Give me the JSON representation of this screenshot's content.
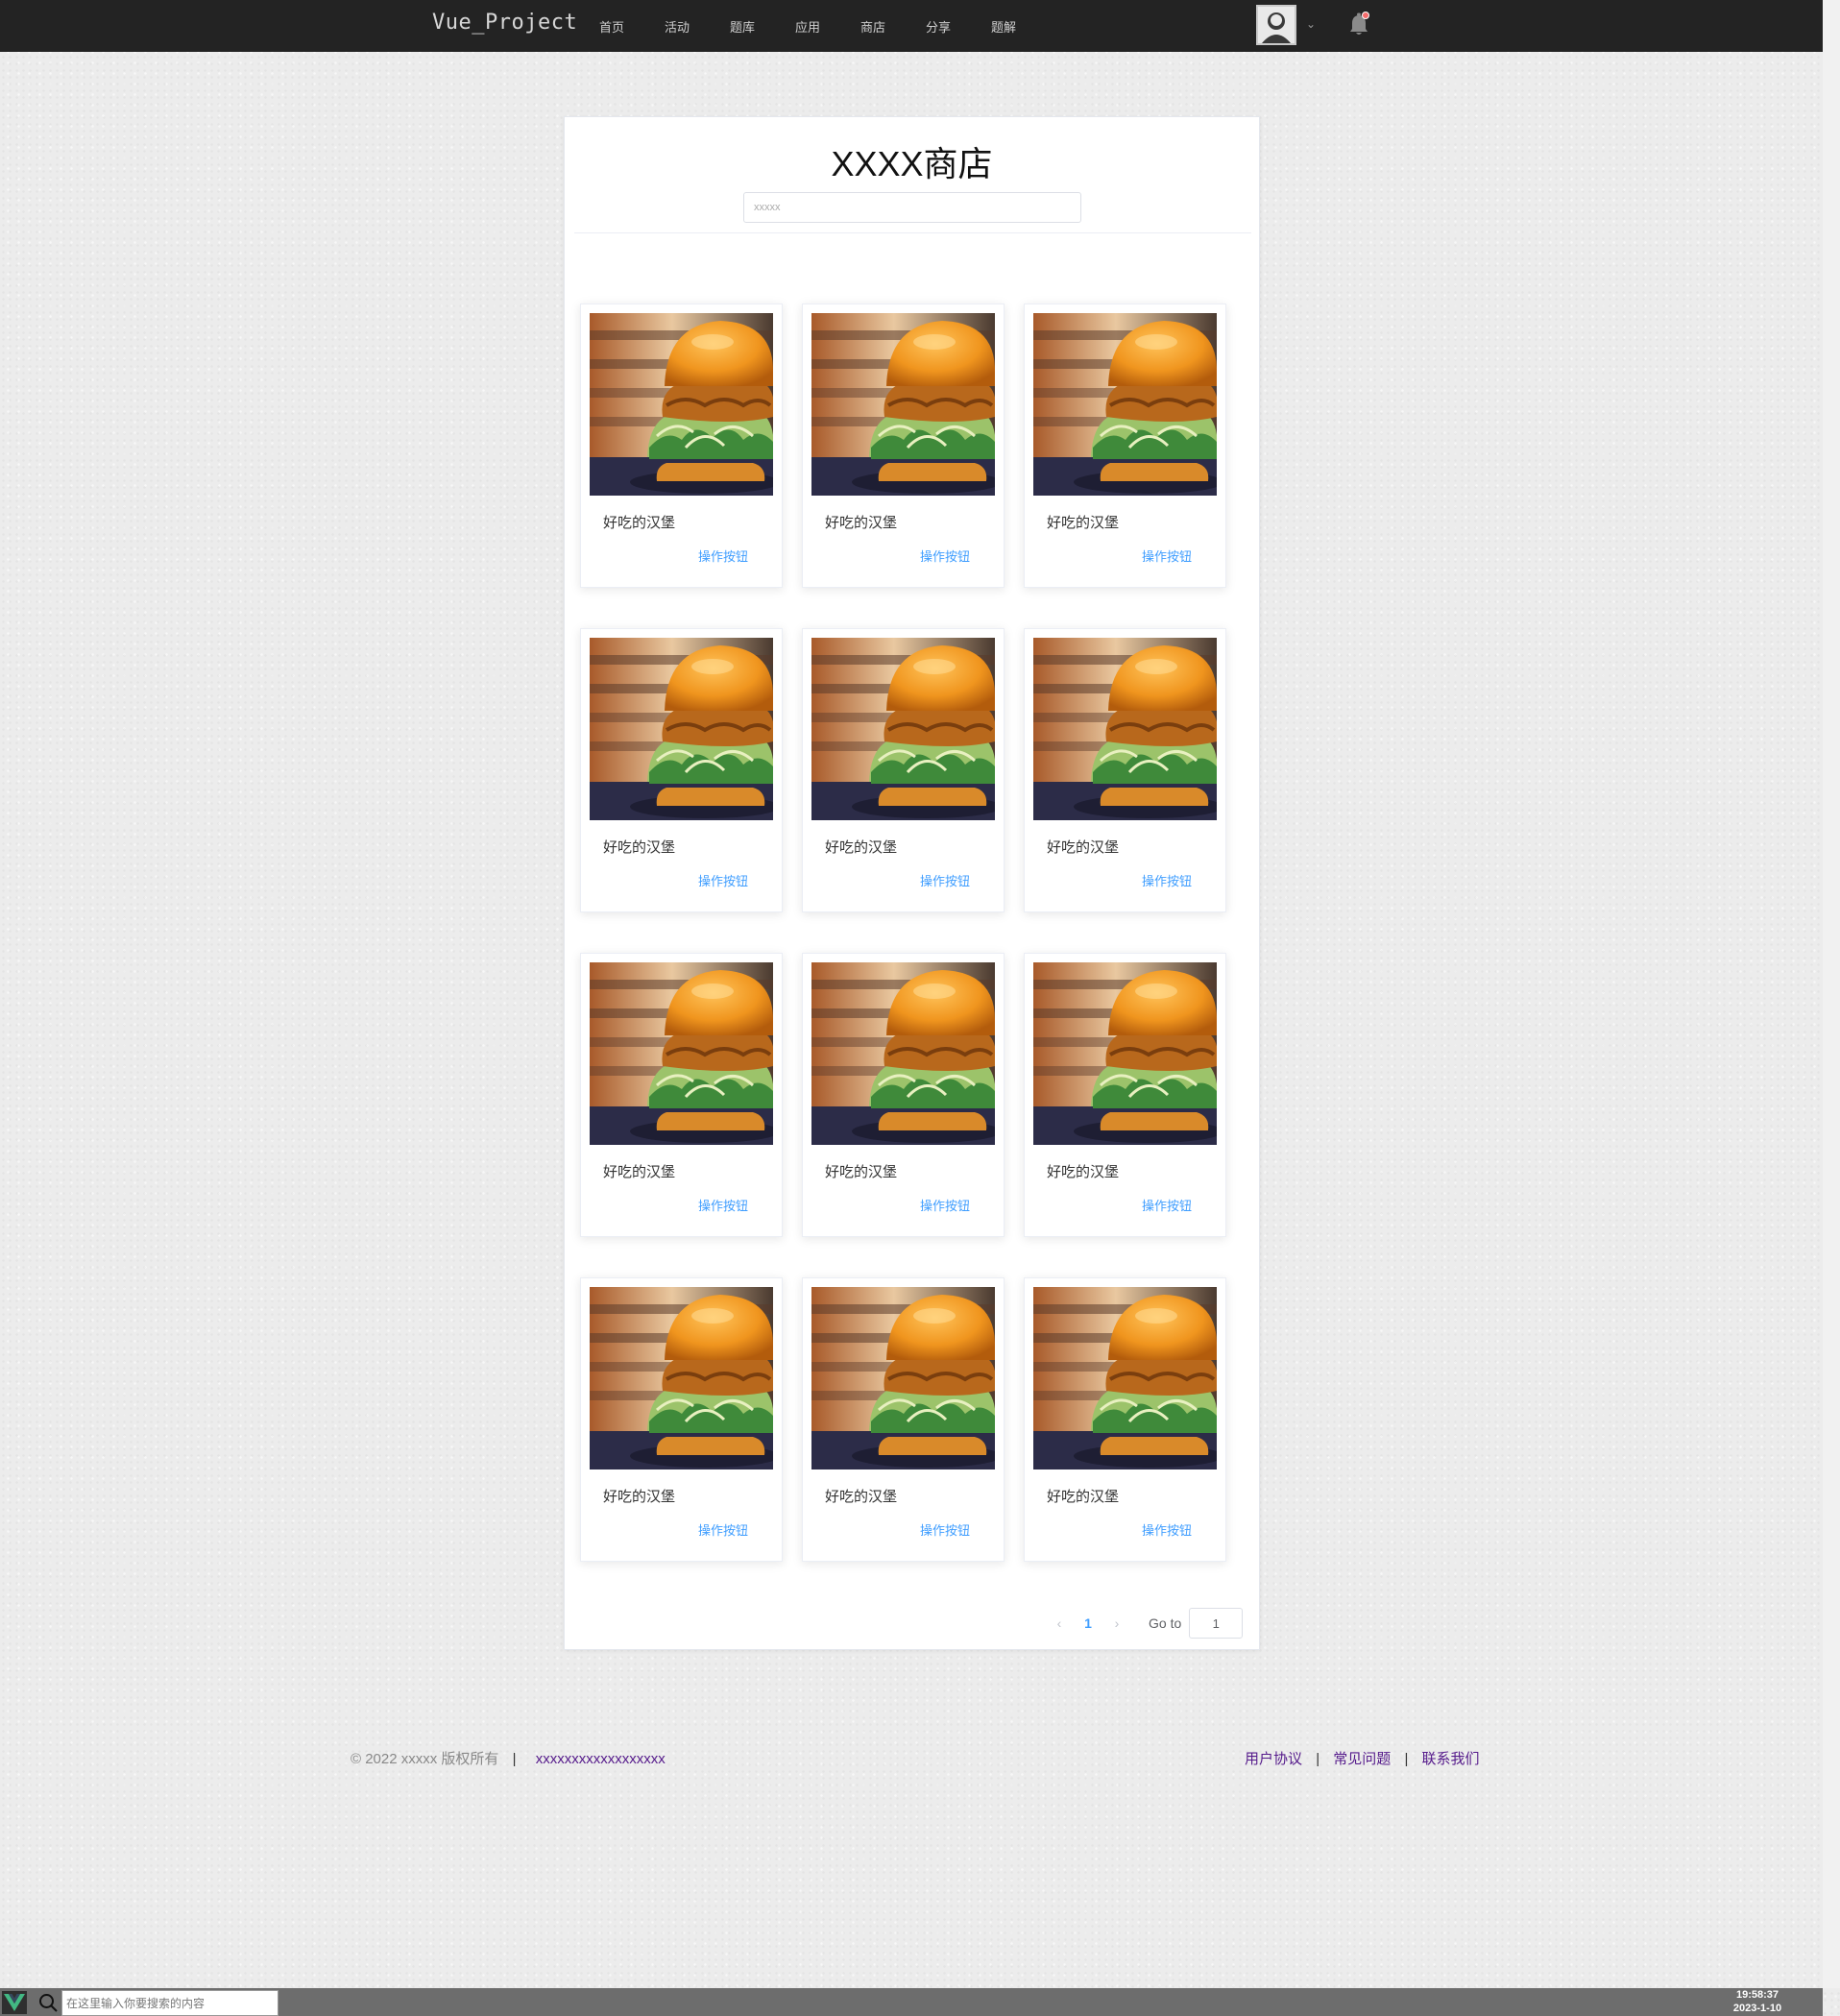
{
  "header": {
    "brand": "Vue_Project",
    "nav": [
      "首页",
      "活动",
      "题库",
      "应用",
      "商店",
      "分享",
      "题解"
    ],
    "notification_dot_color": "#f56c6c"
  },
  "shop": {
    "title": "XXXX商店",
    "search_placeholder": "xxxxx"
  },
  "products": [
    {
      "name": "好吃的汉堡",
      "action": "操作按钮"
    },
    {
      "name": "好吃的汉堡",
      "action": "操作按钮"
    },
    {
      "name": "好吃的汉堡",
      "action": "操作按钮"
    },
    {
      "name": "好吃的汉堡",
      "action": "操作按钮"
    },
    {
      "name": "好吃的汉堡",
      "action": "操作按钮"
    },
    {
      "name": "好吃的汉堡",
      "action": "操作按钮"
    },
    {
      "name": "好吃的汉堡",
      "action": "操作按钮"
    },
    {
      "name": "好吃的汉堡",
      "action": "操作按钮"
    },
    {
      "name": "好吃的汉堡",
      "action": "操作按钮"
    },
    {
      "name": "好吃的汉堡",
      "action": "操作按钮"
    },
    {
      "name": "好吃的汉堡",
      "action": "操作按钮"
    },
    {
      "name": "好吃的汉堡",
      "action": "操作按钮"
    }
  ],
  "pagination": {
    "prev": "‹",
    "next": "›",
    "current_page": "1",
    "goto_label": "Go to",
    "goto_value": "1"
  },
  "footer": {
    "copyright": "© 2022 xxxxx 版权所有",
    "divider": "|",
    "link": "xxxxxxxxxxxxxxxxxx",
    "links": [
      "用户协议",
      "常见问题",
      "联系我们"
    ]
  },
  "taskbar": {
    "search_placeholder": "在这里输入你要搜索的内容",
    "time": "19:58:37",
    "date": "2023-1-10"
  },
  "colors": {
    "accent": "#409eff",
    "topbar": "#232323",
    "link": "#551a8b"
  }
}
